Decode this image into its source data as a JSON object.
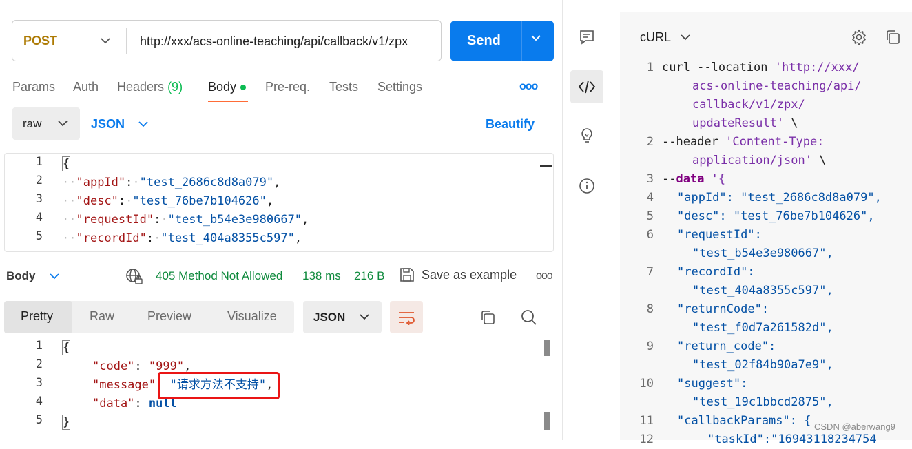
{
  "request": {
    "method": "POST",
    "url": "http://xxx/acs-online-teaching/api/callback/v1/zpx",
    "send_label": "Send"
  },
  "tabs": {
    "params": "Params",
    "auth": "Auth",
    "headers": "Headers",
    "headers_count": "(9)",
    "body": "Body",
    "prereq": "Pre-req.",
    "tests": "Tests",
    "settings": "Settings",
    "more": "ooo"
  },
  "body_controls": {
    "mode": "raw",
    "format": "JSON",
    "beautify": "Beautify"
  },
  "request_body": {
    "lines": [
      {
        "n": "1",
        "text": "{"
      },
      {
        "n": "2",
        "key": "\"appId\"",
        "value": "\"test_2686c8d8a079\""
      },
      {
        "n": "3",
        "key": "\"desc\"",
        "value": "\"test_76be7b104626\""
      },
      {
        "n": "4",
        "key": "\"requestId\"",
        "value": "\"test_b54e3e980667\""
      },
      {
        "n": "5",
        "key": "\"recordId\"",
        "value": "\"test_404a8355c597\""
      }
    ]
  },
  "response": {
    "title": "Body",
    "status": "405 Method Not Allowed",
    "time": "138 ms",
    "size": "216 B",
    "save_example": "Save as example",
    "more": "ooo",
    "view_tabs": [
      "Pretty",
      "Raw",
      "Preview",
      "Visualize"
    ],
    "format": "JSON",
    "lines": {
      "l1": "{",
      "code_key": "\"code\"",
      "code_val": "\"999\"",
      "message_key": "\"message\"",
      "message_val": "\"请求方法不支持\"",
      "data_key": "\"data\"",
      "data_val": "null",
      "l5": "}"
    },
    "line_numbers": [
      "1",
      "2",
      "3",
      "4",
      "5"
    ]
  },
  "code_panel": {
    "title": "cURL",
    "lines": [
      {
        "n": "1",
        "t": "curl --location 'http://xxx/"
      },
      {
        "n": "",
        "t": "acs-online-teaching/api/"
      },
      {
        "n": "",
        "t": "callback/v1/zpx/"
      },
      {
        "n": "",
        "t": "updateResult' \\"
      },
      {
        "n": "2",
        "t": "--header 'Content-Type:"
      },
      {
        "n": "",
        "t": "application/json' \\"
      },
      {
        "n": "3",
        "t": "--data '{"
      },
      {
        "n": "4",
        "t": "\"appId\": \"test_2686c8d8a079\","
      },
      {
        "n": "5",
        "t": "\"desc\": \"test_76be7b104626\","
      },
      {
        "n": "6",
        "t": "\"requestId\":"
      },
      {
        "n": "",
        "t": "\"test_b54e3e980667\","
      },
      {
        "n": "7",
        "t": "\"recordId\":"
      },
      {
        "n": "",
        "t": "\"test_404a8355c597\","
      },
      {
        "n": "8",
        "t": "\"returnCode\":"
      },
      {
        "n": "",
        "t": "\"test_f0d7a261582d\","
      },
      {
        "n": "9",
        "t": "\"return_code\":"
      },
      {
        "n": "",
        "t": "\"test_02f84b90a7e9\","
      },
      {
        "n": "10",
        "t": "\"suggest\":"
      },
      {
        "n": "",
        "t": "\"test_19c1bbcd2875\","
      },
      {
        "n": "11",
        "t": "\"callbackParams\": {"
      },
      {
        "n": "12",
        "t": "\"taskId\":\"16943118234754"
      }
    ]
  },
  "watermark": "CSDN @aberwang9",
  "colors": {
    "accent": "#097bed",
    "post": "#ad7a03",
    "status_ok": "#0f8a3d",
    "tab_underline": "#ff6c37",
    "highlight_box": "#ea1515"
  }
}
